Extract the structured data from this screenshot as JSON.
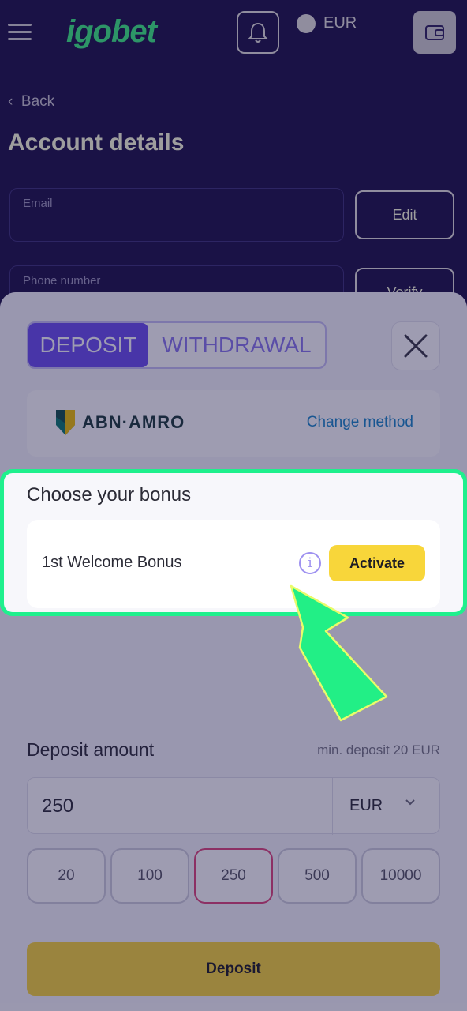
{
  "header": {
    "logo": "igobet",
    "balance": "EUR"
  },
  "background": {
    "back_label": "Back",
    "title": "Account details",
    "email_label": "Email",
    "edit_label": "Edit",
    "phone_label": "Phone number",
    "verify_label": "Verify"
  },
  "sheet": {
    "tabs": [
      "DEPOSIT",
      "WITHDRAWAL"
    ],
    "method": {
      "bank_name": "ABN·AMRO",
      "change_label": "Change method"
    },
    "bonus": {
      "title": "Choose your bonus",
      "name": "1st Welcome Bonus",
      "activate_label": "Activate"
    },
    "amount": {
      "label": "Deposit amount",
      "min_text": "min. deposit 20 EUR",
      "value": "250",
      "currency": "EUR"
    },
    "quick_amounts": [
      "20",
      "100",
      "250",
      "500",
      "10000"
    ],
    "selected_quick": "250",
    "deposit_label": "Deposit"
  },
  "colors": {
    "accent": "#6b4ff0",
    "highlight": "#1ff08d",
    "button": "#f8d63a"
  }
}
